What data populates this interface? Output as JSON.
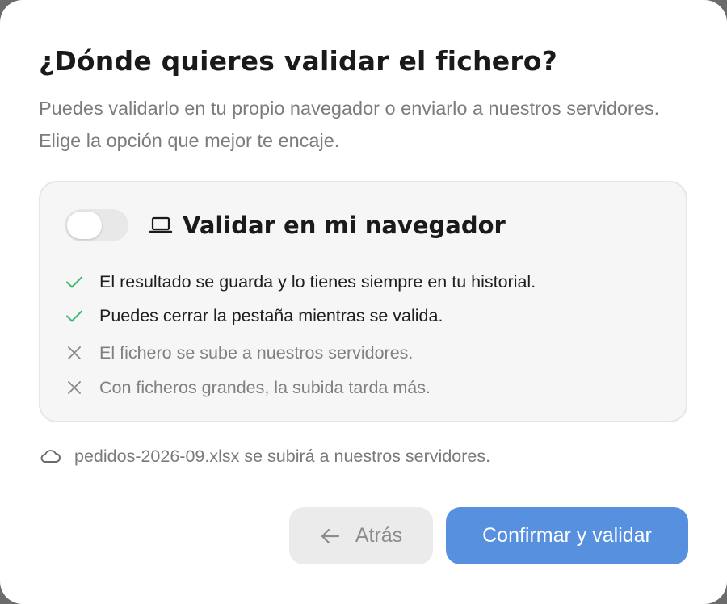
{
  "dialog": {
    "title": "¿Dónde quieres validar el fichero?",
    "subtitle": "Puedes validarlo en tu propio navegador o enviarlo a nuestros servidores. Elige la opción que mejor te encaje."
  },
  "option": {
    "title": "Validar en mi navegador",
    "toggle_on": false,
    "icon": "laptop-icon",
    "pros": [
      "El resultado se guarda y lo tienes siempre en tu historial.",
      "Puedes cerrar la pestaña mientras se valida."
    ],
    "cons": [
      "El fichero se sube a nuestros servidores.",
      "Con ficheros grandes, la subida tarda más."
    ]
  },
  "note": {
    "icon": "cloud-icon",
    "text": "pedidos-2026-09.xlsx se subirá a nuestros servidores."
  },
  "buttons": {
    "back_label": "Atrás",
    "confirm_label": "Confirmar y validar"
  },
  "colors": {
    "accent": "#5890e0",
    "check": "#3dbb6e",
    "cross": "#8a8a8a"
  }
}
